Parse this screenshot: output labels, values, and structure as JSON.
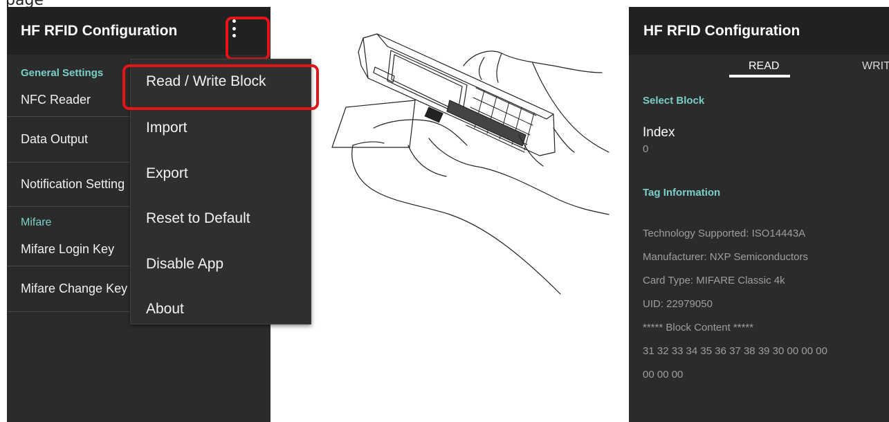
{
  "page_label": "page",
  "left": {
    "title": "HF RFID Configuration",
    "sections": {
      "general": "General Settings",
      "mifare": "Mifare"
    },
    "items": {
      "nfc_reader": "NFC Reader",
      "data_output": "Data Output",
      "notification": "Notification Setting",
      "mifare_login": "Mifare Login Key",
      "mifare_change": "Mifare Change Key"
    }
  },
  "menu": {
    "items": [
      "Read / Write Block",
      "Import",
      "Export",
      "Reset to Default",
      "Disable App",
      "About"
    ]
  },
  "right": {
    "title": "HF RFID Configuration",
    "tabs": [
      "READ",
      "WRITE"
    ],
    "select_block": "Select Block",
    "index_label": "Index",
    "index_value": "0",
    "tag_info_header": "Tag Information",
    "tag_info_lines": [
      "Technology Supported: ISO14443A",
      "Manufacturer: NXP Semiconductors",
      "Card Type: MIFARE Classic 4k",
      "UID: 22979050",
      "***** Block Content *****",
      "31 32 33 34 35 36 37 38 39 30 00 00 00",
      "00 00 00"
    ]
  },
  "colors": {
    "accent": "#7ad0c8",
    "highlight": "#e4141b",
    "appbar": "#212121",
    "screen": "#2b2b2b"
  },
  "icons": {
    "overflow": "more-vert-icon",
    "illustration": "scanner-tapping-card-illustration"
  }
}
